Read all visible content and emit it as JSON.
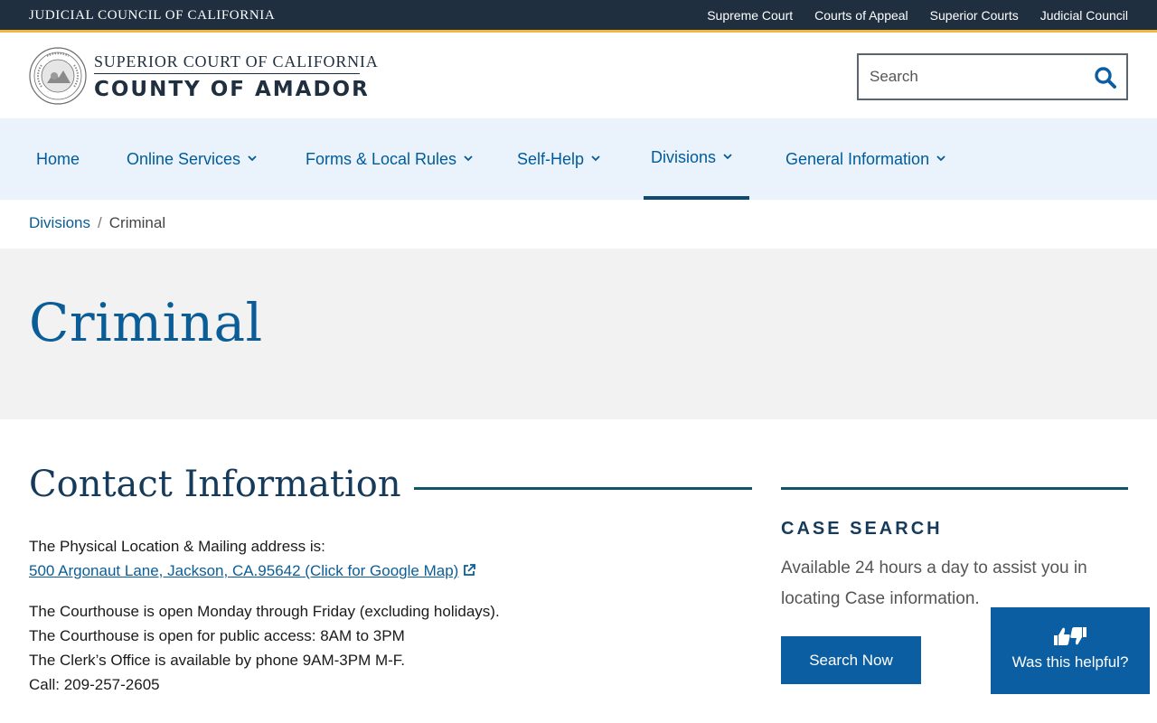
{
  "utility": {
    "title": "JUDICIAL COUNCIL OF CALIFORNIA",
    "links": [
      "Supreme Court",
      "Courts of Appeal",
      "Superior Courts",
      "Judicial Council"
    ]
  },
  "header": {
    "line1": "SUPERIOR COURT OF CALIFORNIA",
    "line2": "COUNTY OF AMADOR",
    "search_placeholder": "Search"
  },
  "nav": {
    "items": [
      "Home",
      "Online Services",
      "Forms & Local Rules",
      "Self-Help",
      "Divisions",
      "General Information"
    ],
    "active": "Divisions"
  },
  "breadcrumb": {
    "parent": "Divisions",
    "separator": "/",
    "current": "Criminal"
  },
  "page": {
    "title": "Criminal"
  },
  "contact": {
    "heading": "Contact Information",
    "address_intro": "The Physical Location & Mailing address is:",
    "address_link": "500 Argonaut Lane, Jackson, CA.95642 (Click for Google Map)",
    "hours1": "The Courthouse is open Monday through Friday (excluding holidays).",
    "hours2": "The Courthouse is open for public access: 8AM to 3PM",
    "hours3": "The Clerk’s Office is available by phone 9AM-3PM M-F.",
    "phone": "Call: 209-257-2605"
  },
  "sidebar": {
    "heading": "CASE SEARCH",
    "text": "Available 24 hours a day to assist you in locating Case information.",
    "button": "Search Now"
  },
  "feedback": {
    "label": "Was this helpful?"
  },
  "colors": {
    "utility_bg": "#1f2f3f",
    "accent_gold": "#f0b63d",
    "link_blue": "#0a5d97",
    "nav_bg": "#eaf3fb",
    "button_blue": "#0a5ea1"
  }
}
